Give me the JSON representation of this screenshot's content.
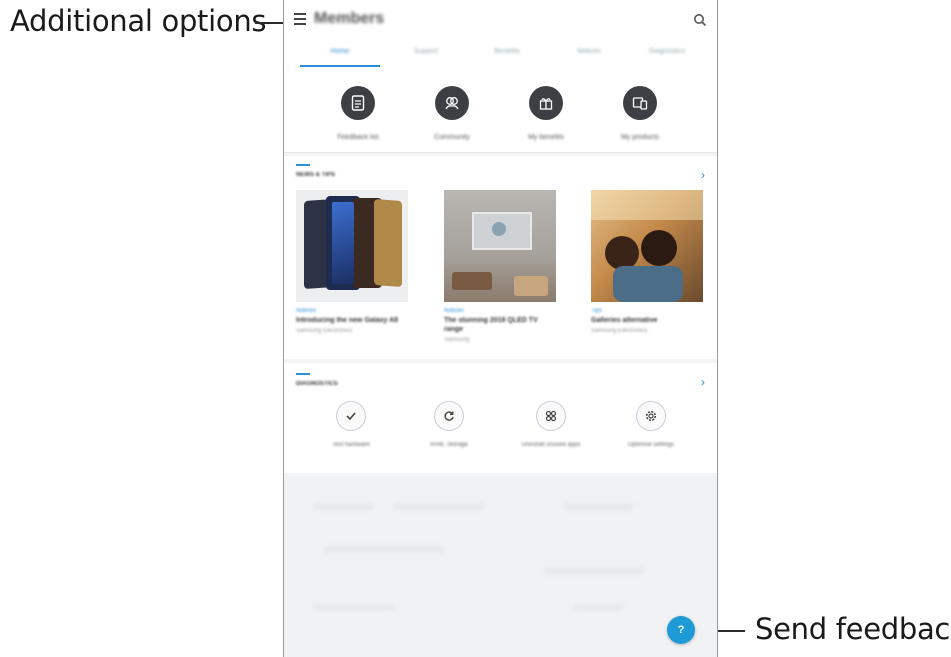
{
  "callouts": {
    "additional_options": "Additional options",
    "send_feedback": "Send feedback."
  },
  "appbar": {
    "title": "Members",
    "menu_icon": "hamburger-menu-icon",
    "search_icon": "search-icon"
  },
  "tabs": [
    "Home",
    "Support",
    "Benefits",
    "Notices",
    "Diagnostics"
  ],
  "quick_actions": [
    {
      "label": "Feedback list",
      "icon": "document-icon"
    },
    {
      "label": "Community",
      "icon": "people-icon"
    },
    {
      "label": "My benefits",
      "icon": "gift-icon"
    },
    {
      "label": "My products",
      "icon": "devices-icon"
    }
  ],
  "news_section": {
    "title": "NEWS & TIPS",
    "items": [
      {
        "category": "Notices",
        "title": "Introducing the new Galaxy A8",
        "sub": "Samsung Electronics"
      },
      {
        "category": "Notices",
        "title": "The stunning 2018 QLED TV range",
        "sub": "Samsung"
      },
      {
        "category": "Tips",
        "title": "Galleries alternative",
        "sub": "Samsung Electronics"
      }
    ]
  },
  "diagnostics_section": {
    "title": "DIAGNOSTICS",
    "items": [
      {
        "label": "Test hardware",
        "icon": "check-icon"
      },
      {
        "label": "RAM, Storage",
        "icon": "refresh-icon"
      },
      {
        "label": "Uninstall unused apps",
        "icon": "apps-grid-icon"
      },
      {
        "label": "Optimise settings",
        "icon": "settings-gear-icon"
      }
    ]
  },
  "fab": {
    "label": "?"
  },
  "colors": {
    "accent": "#2a8fd4",
    "fab": "#1e9ad6",
    "dark_circle": "#3c3f44"
  }
}
